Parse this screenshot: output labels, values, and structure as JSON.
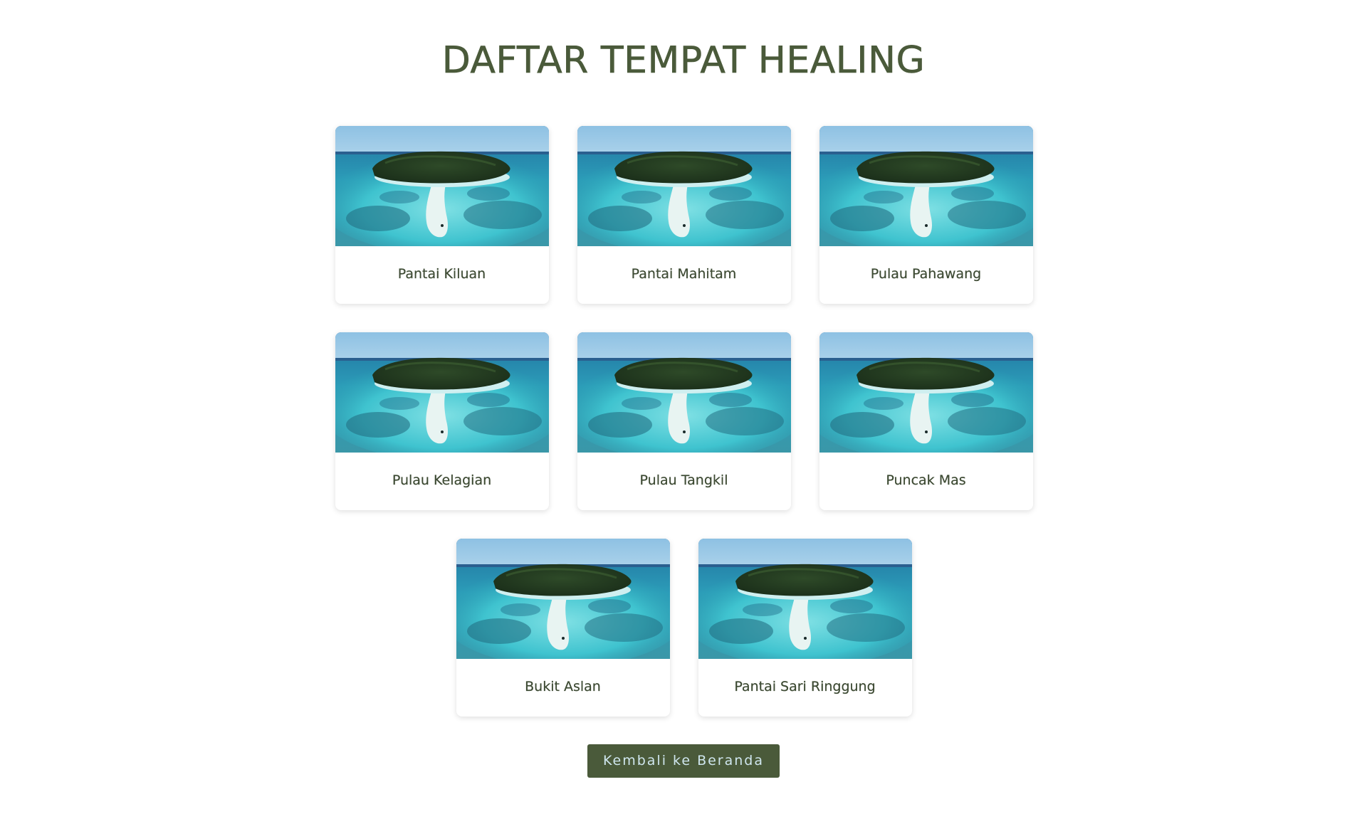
{
  "page": {
    "title": "DAFTAR TEMPAT HEALING"
  },
  "places": [
    {
      "name": "Pantai Kiluan",
      "image": "island-aerial-photo"
    },
    {
      "name": "Pantai Mahitam",
      "image": "island-aerial-photo"
    },
    {
      "name": "Pulau Pahawang",
      "image": "island-aerial-photo"
    },
    {
      "name": "Pulau Kelagian",
      "image": "island-aerial-photo"
    },
    {
      "name": "Pulau Tangkil",
      "image": "island-aerial-photo"
    },
    {
      "name": "Puncak Mas",
      "image": "island-aerial-photo"
    },
    {
      "name": "Bukit Aslan",
      "image": "island-aerial-photo"
    },
    {
      "name": "Pantai Sari Ringgung",
      "image": "island-aerial-photo"
    }
  ],
  "footer": {
    "back_button_label": "Kembali ke Beranda"
  },
  "colors": {
    "title": "#4a5a3a",
    "button_bg": "#4a5a3a",
    "button_text": "#cfe6ee",
    "card_text": "#3d4a33"
  }
}
